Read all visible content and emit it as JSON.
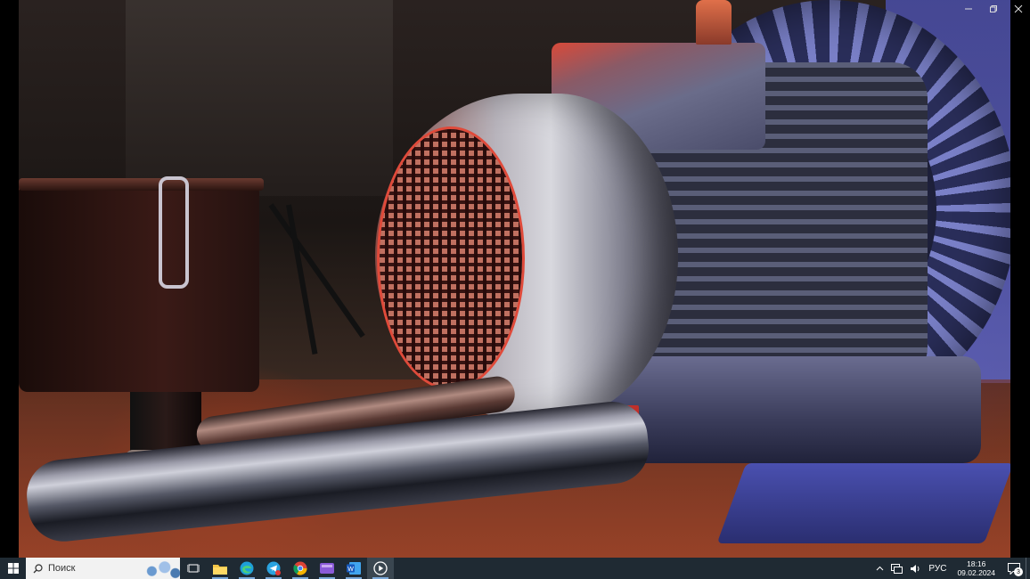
{
  "photo_viewer": {
    "window_controls": {
      "minimize_icon": "minimize-icon",
      "maximize_icon": "restore-icon",
      "close_icon": "close-icon"
    },
    "image_subject": "industrial side channel blower motor"
  },
  "taskbar": {
    "search": {
      "placeholder": "Поиск"
    },
    "apps": [
      {
        "name": "task-view",
        "icon": "task-view-icon"
      },
      {
        "name": "file-explorer",
        "icon": "folder-icon"
      },
      {
        "name": "edge",
        "icon": "edge-icon"
      },
      {
        "name": "telegram",
        "icon": "telegram-icon"
      },
      {
        "name": "chrome",
        "icon": "chrome-icon"
      },
      {
        "name": "app-purple",
        "icon": "purple-app-icon"
      },
      {
        "name": "word",
        "icon": "word-icon"
      },
      {
        "name": "media-player",
        "icon": "play-icon"
      }
    ],
    "tray": {
      "language": "РУС",
      "time": "18:16",
      "date": "09.02.2024",
      "notification_count": "3"
    }
  },
  "colors": {
    "taskbar_bg": "#1f2a33",
    "accent_underline": "#7aa8d8"
  }
}
